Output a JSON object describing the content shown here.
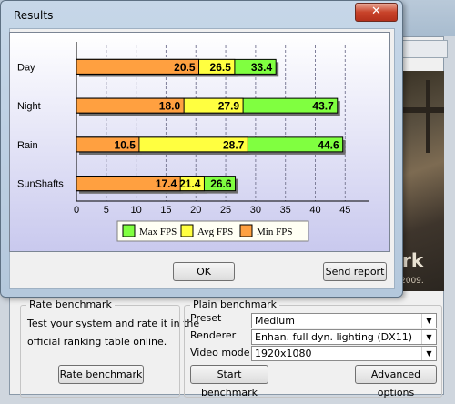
{
  "dialog": {
    "title": "Results",
    "close_glyph": "✕",
    "ok_label": "OK",
    "send_report_label": "Send report"
  },
  "legend": {
    "max": "Max FPS",
    "avg": "Avg FPS",
    "min": "Min FPS"
  },
  "colors": {
    "max": "#80ff40",
    "avg": "#ffff40",
    "min": "#ffa040"
  },
  "chart_data": {
    "type": "bar",
    "orientation": "horizontal",
    "stacked": true,
    "categories": [
      "Day",
      "Night",
      "Rain",
      "SunShafts"
    ],
    "series": [
      {
        "name": "Min FPS",
        "values": [
          20.5,
          18.0,
          10.5,
          17.4
        ]
      },
      {
        "name": "Avg FPS",
        "values": [
          26.5,
          27.9,
          28.7,
          21.4
        ]
      },
      {
        "name": "Max FPS",
        "values": [
          33.4,
          43.7,
          44.6,
          26.6
        ]
      }
    ],
    "value_labels": {
      "min": [
        "20.5",
        "18.0",
        "10.5",
        "17.4"
      ],
      "avg": [
        "26.5",
        "27.9",
        "28.7",
        "21.4"
      ],
      "max": [
        "33.4",
        "43.7",
        "44.6",
        "26.6"
      ]
    },
    "xticks": [
      "0",
      "5",
      "10",
      "15",
      "20",
      "25",
      "30",
      "35",
      "40",
      "45"
    ],
    "xlim": [
      0,
      48
    ],
    "grid": "vertical dashed",
    "legend_position": "bottom"
  },
  "rate_benchmark": {
    "title": "Rate benchmark",
    "desc_line1": "Test your system and rate it in the",
    "desc_line2": "official ranking table online.",
    "button": "Rate benchmark"
  },
  "plain_benchmark": {
    "title": "Plain benchmark",
    "preset_label": "Preset",
    "preset_value": "Medium",
    "renderer_label": "Renderer",
    "renderer_value": "Enhan. full dyn. lighting (DX11)",
    "videomode_label": "Video mode",
    "videomode_value": "1920x1080",
    "start_button": "Start benchmark",
    "advanced_button": "Advanced options"
  },
  "background": {
    "art_word": "rk",
    "art_year": "2009."
  }
}
